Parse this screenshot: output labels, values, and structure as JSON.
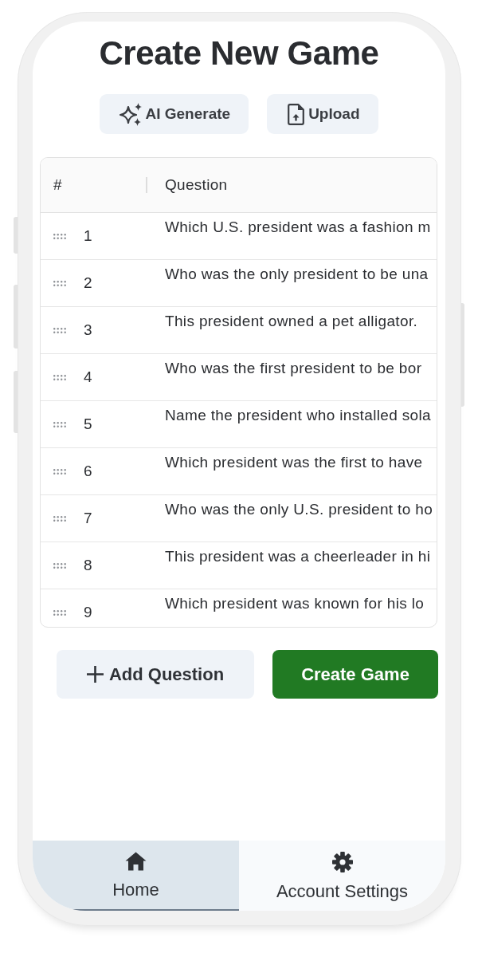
{
  "title": "Create New Game",
  "toolbar": [
    {
      "kind": "ai",
      "label": "AI Generate"
    },
    {
      "kind": "upload",
      "label": "Upload"
    }
  ],
  "table": {
    "columns": [
      "#",
      "Question"
    ],
    "rows": [
      {
        "number": "1",
        "question": "Which U.S. president was a fashion m"
      },
      {
        "number": "2",
        "question": "Who was the only president to be una"
      },
      {
        "number": "3",
        "question": "This president owned a pet alligator."
      },
      {
        "number": "4",
        "question": "Who was the first president to be bor"
      },
      {
        "number": "5",
        "question": "Name the president who installed sola"
      },
      {
        "number": "6",
        "question": "Which president was the first to have"
      },
      {
        "number": "7",
        "question": "Who was the only U.S. president to ho"
      },
      {
        "number": "8",
        "question": "This president was a cheerleader in hi"
      },
      {
        "number": "9",
        "question": "Which president was known for his lo"
      }
    ]
  },
  "actions": [
    {
      "kind": "add",
      "label": "Add Question"
    },
    {
      "kind": "create",
      "label": "Create Game"
    }
  ],
  "bottom_nav": [
    {
      "kind": "home",
      "label": "Home",
      "selected": true
    },
    {
      "kind": "settings",
      "label": "Account Settings",
      "selected": false
    }
  ]
}
